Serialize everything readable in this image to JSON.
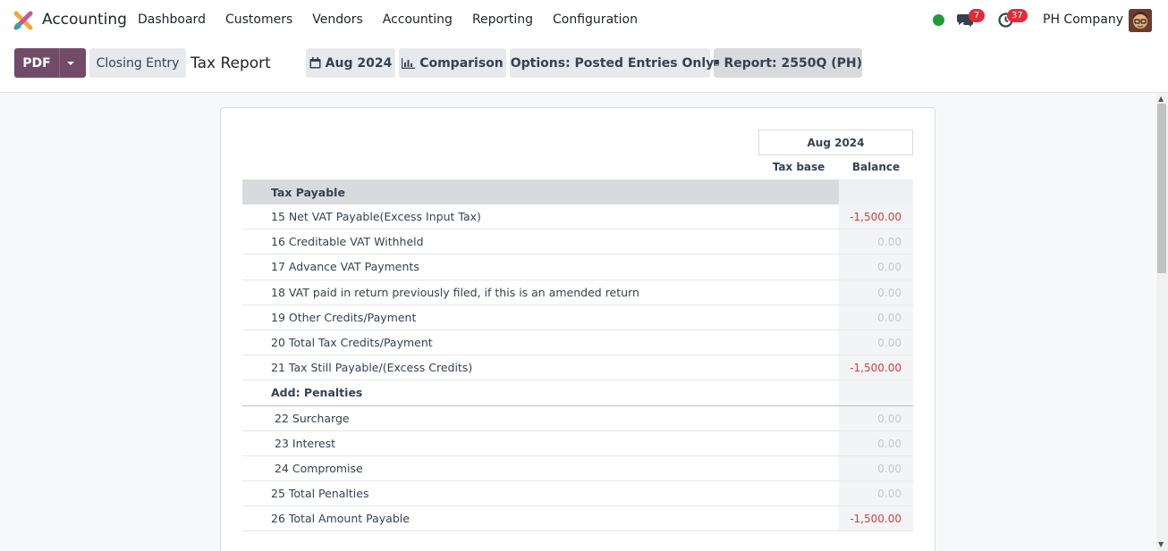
{
  "navbar": {
    "app_name": "Accounting",
    "menu": [
      "Dashboard",
      "Customers",
      "Vendors",
      "Accounting",
      "Reporting",
      "Configuration"
    ],
    "messages_count": "7",
    "activities_count": "37",
    "company": "PH Company",
    "status_color": "#1d9b3a"
  },
  "control_panel": {
    "pdf_label": "PDF",
    "closing_entry_label": "Closing Entry",
    "title": "Tax Report",
    "date_filter_label": "Aug 2024",
    "comparison_label": "Comparison",
    "options_label": "Options: Posted Entries Only",
    "report_label": "Report: 2550Q (PH)"
  },
  "report": {
    "period": "Aug 2024",
    "columns": [
      "Tax base",
      "Balance"
    ],
    "rows": [
      {
        "label": "Tax Payable",
        "balance": "",
        "type": "header"
      },
      {
        "label": "15 Net VAT Payable(Excess Input Tax)",
        "balance": "-1,500.00",
        "negative": true
      },
      {
        "label": "16 Creditable VAT Withheld",
        "balance": "0.00"
      },
      {
        "label": "17 Advance VAT Payments",
        "balance": "0.00"
      },
      {
        "label": "18 VAT paid in return previously filed, if this is an amended return",
        "balance": "0.00"
      },
      {
        "label": "19 Other Credits/Payment",
        "balance": "0.00"
      },
      {
        "label": "20 Total Tax Credits/Payment",
        "balance": "0.00"
      },
      {
        "label": "21 Tax Still Payable/(Excess Credits)",
        "balance": "-1,500.00",
        "negative": true
      },
      {
        "label": "Add: Penalties",
        "balance": "",
        "type": "bold"
      },
      {
        "label": "22 Surcharge",
        "balance": "0.00",
        "indent": true
      },
      {
        "label": "23 Interest",
        "balance": "0.00",
        "indent": true
      },
      {
        "label": "24 Compromise",
        "balance": "0.00",
        "indent": true
      },
      {
        "label": "25 Total Penalties",
        "balance": "0.00"
      },
      {
        "label": "26 Total Amount Payable",
        "balance": "-1,500.00",
        "negative": true
      }
    ]
  }
}
